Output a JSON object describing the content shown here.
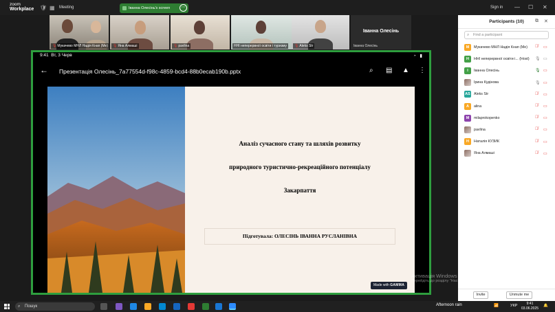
{
  "titlebar": {
    "app_name_line1": "zoom",
    "app_name_line2": "Workplace",
    "meeting_label": "Meeting",
    "share_label": "Іванна Олесінь's screen",
    "signin": "Sign in"
  },
  "video_strip": [
    {
      "name": "Мукачево МНЛ Надія Кнап (Me)",
      "muted": true
    },
    {
      "name": "Яна Алмаші",
      "muted": true
    },
    {
      "name": "pavlina",
      "muted": true
    },
    {
      "name": "",
      "muted": false
    },
    {
      "name": "ННІ неперервної освіти і туризму",
      "muted": false
    },
    {
      "name": "Aleks Str",
      "muted": true
    },
    {
      "name": "Іванна Олесінь",
      "muted": false,
      "big_name": "Іванна Олесінь"
    }
  ],
  "screen_share": {
    "status_time": "9:41",
    "status_date": "Вт, 3 Черв",
    "file_title": "Презентація Олесінь_7a77554d-f98c-4859-bcd4-88b0ecab190b.pptx",
    "slide": {
      "title": "Аналіз сучасного стану та шляхів розвитку природного туристично-рекреаційного потенціалу Закарпаття",
      "title_lines": [
        "Аналіз сучасного стану та шляхів розвитку",
        "природного туристично-рекреаційного потенціалу",
        "Закарпаття"
      ],
      "prepared_by": "Підготувала: ОЛЕСІНЬ ІВАННА РУСЛАНІВНА",
      "made_with": "Made with",
      "made_with_brand": "GAMMA"
    }
  },
  "participants_panel": {
    "title": "Participants (10)",
    "search_placeholder": "Find a participant",
    "participants": [
      {
        "initial": "M",
        "color": "#f9a825",
        "name": "Мукачево МНЛ Надія Кнап (Me)",
        "mic": "off",
        "video": "off"
      },
      {
        "initial": "H",
        "color": "#43a047",
        "name": "ННІ неперервної освіти і... (Host)",
        "mic": "on",
        "video": "on"
      },
      {
        "initial": "I",
        "color": "#43a047",
        "name": "Іванна Олесінь",
        "mic": "active",
        "video": "off"
      },
      {
        "initial": "",
        "color": "photo",
        "name": "Ірина Кудінова",
        "mic": "on",
        "video": "off"
      },
      {
        "initial": "AS",
        "color": "#26a69a",
        "name": "Aleks Str",
        "mic": "off",
        "video": "off"
      },
      {
        "initial": "A",
        "color": "#f9a825",
        "name": "alina",
        "mic": "off",
        "video": "off"
      },
      {
        "initial": "M",
        "color": "#8e44ad",
        "name": "milaprokopenko",
        "mic": "off",
        "video": "off"
      },
      {
        "initial": "",
        "color": "photo",
        "name": "pavlina",
        "mic": "off",
        "video": "off"
      },
      {
        "initial": "H",
        "color": "#f9a825",
        "name": "Наталія КУЗИК",
        "mic": "off",
        "video": "off"
      },
      {
        "initial": "",
        "color": "photo",
        "name": "Яна Алмаші",
        "mic": "off",
        "video": "off"
      }
    ],
    "invite_label": "Invite",
    "unmute_label": "Unmute me"
  },
  "watermark": {
    "line1": "Активація Windows",
    "line2": "Перейдіть до розділу \"Настройки\", щоб активувати Windows."
  },
  "taskbar": {
    "search_label": "Пошук",
    "weather": "Afternoon rain",
    "language": "УКР",
    "time": "9:41",
    "date": "03.06.2025"
  },
  "colors": {
    "share_border": "#2e9e3e",
    "muted_red": "#e53935",
    "panel_bg": "#ffffff"
  }
}
